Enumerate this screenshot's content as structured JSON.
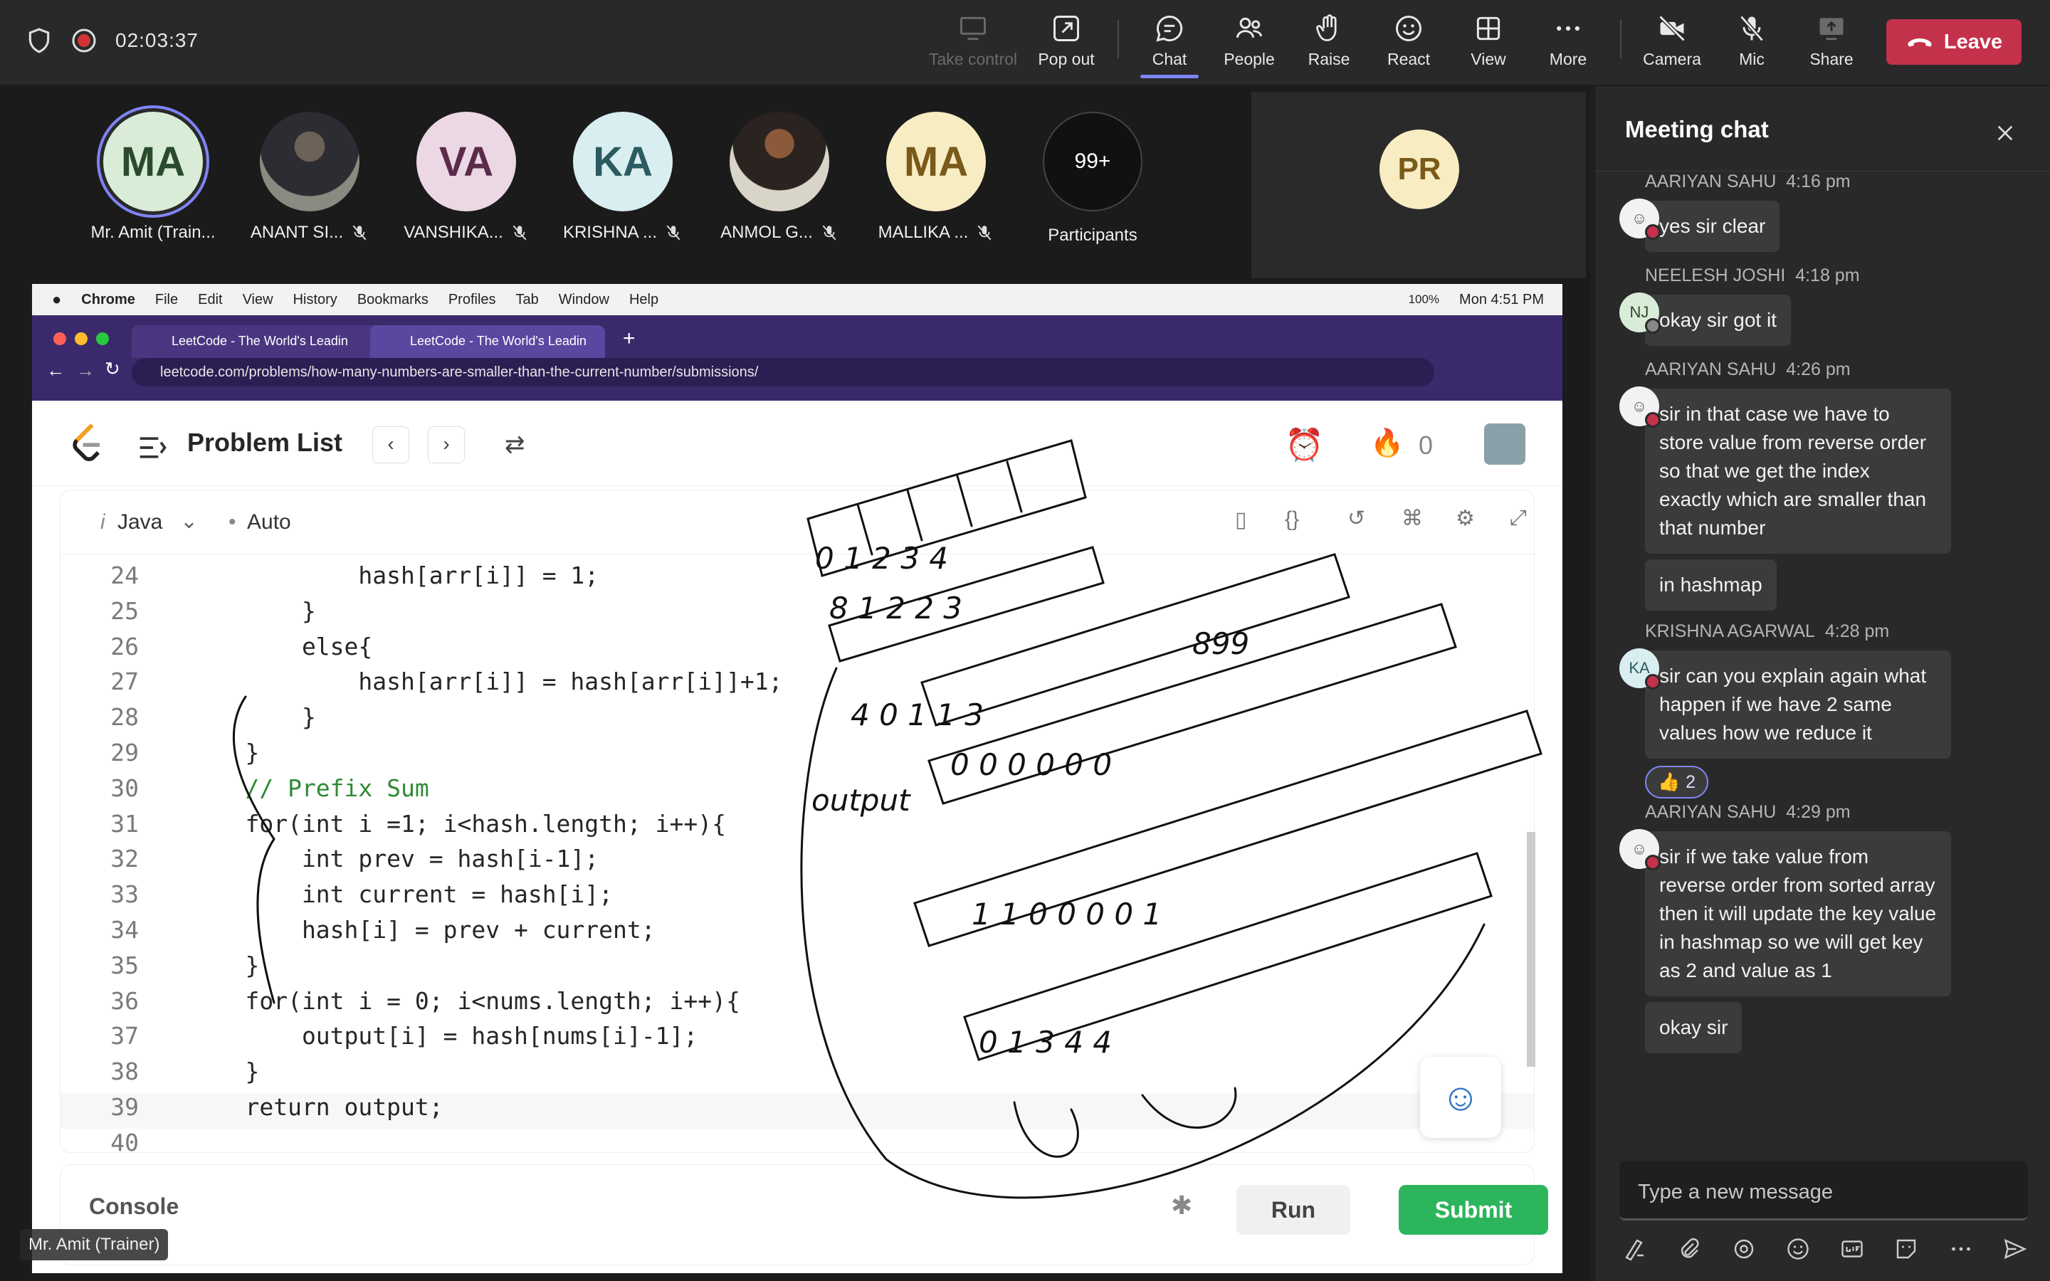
{
  "topbar": {
    "timer": "02:03:37",
    "buttons": {
      "take_control": "Take control",
      "pop_out": "Pop out",
      "chat": "Chat",
      "people": "People",
      "raise": "Raise",
      "react": "React",
      "view": "View",
      "more": "More",
      "camera": "Camera",
      "mic": "Mic",
      "share": "Share",
      "leave": "Leave"
    }
  },
  "participants": [
    {
      "initials": "MA",
      "name": "Mr. Amit (Train..."
    },
    {
      "initials": "",
      "name": "ANANT SI..."
    },
    {
      "initials": "VA",
      "name": "VANSHIKA..."
    },
    {
      "initials": "KA",
      "name": "KRISHNA ..."
    },
    {
      "initials": "",
      "name": "ANMOL G..."
    },
    {
      "initials": "MA",
      "name": "MALLIKA ..."
    }
  ],
  "participants_more": {
    "count": "99+",
    "label": "Participants"
  },
  "pinned_tile": {
    "initials": "PR"
  },
  "shared_screen": {
    "mac_menu": [
      "Chrome",
      "File",
      "Edit",
      "View",
      "History",
      "Bookmarks",
      "Profiles",
      "Tab",
      "Window",
      "Help"
    ],
    "mac_status": {
      "battery": "100%",
      "clock": "Mon 4:51 PM"
    },
    "tabs": [
      "LeetCode - The World's Leadin",
      "LeetCode - The World's Leadin"
    ],
    "url": "leetcode.com/problems/how-many-numbers-are-smaller-than-the-current-number/submissions/",
    "problem_list": "Problem List",
    "streak": "0",
    "language": "Java",
    "autosave": "Auto",
    "code_lines": [
      {
        "n": "24",
        "t": "            hash[arr[i]] = 1;"
      },
      {
        "n": "25",
        "t": "        }"
      },
      {
        "n": "26",
        "t": "        else{"
      },
      {
        "n": "27",
        "t": "            hash[arr[i]] = hash[arr[i]]+1;"
      },
      {
        "n": "28",
        "t": "        }"
      },
      {
        "n": "29",
        "t": "    }"
      },
      {
        "n": "30",
        "t": "    // Prefix Sum"
      },
      {
        "n": "31",
        "t": "    for(int i =1; i<hash.length; i++){"
      },
      {
        "n": "32",
        "t": "        int prev = hash[i-1];"
      },
      {
        "n": "33",
        "t": "        int current = hash[i];"
      },
      {
        "n": "34",
        "t": "        hash[i] = prev + current;"
      },
      {
        "n": "35",
        "t": "    }"
      },
      {
        "n": "36",
        "t": "    for(int i = 0; i<nums.length; i++){"
      },
      {
        "n": "37",
        "t": "        output[i] = hash[nums[i]-1];"
      },
      {
        "n": "38",
        "t": "    }"
      },
      {
        "n": "39",
        "t": "    return output;"
      },
      {
        "n": "40",
        "t": ""
      }
    ],
    "console": "Console",
    "run": "Run",
    "submit": "Submit",
    "presenter_tag": "Mr. Amit (Trainer)"
  },
  "chat": {
    "title": "Meeting chat",
    "messages": [
      {
        "author": "AARIYAN SAHU",
        "time": "4:16 pm",
        "text": "yes sir clear"
      },
      {
        "author": "NEELESH JOSHI",
        "time": "4:18 pm",
        "initials": "NJ",
        "text": "okay sir got it"
      },
      {
        "author": "AARIYAN SAHU",
        "time": "4:26 pm",
        "text": "sir in that case we have to store value from reverse order so that we get the index exactly which are smaller than that number",
        "text2": "in hashmap"
      },
      {
        "author": "KRISHNA AGARWAL",
        "time": "4:28 pm",
        "initials": "KA",
        "text": "sir can you explain again what happen if we have 2 same values how we reduce it",
        "reaction": "2"
      },
      {
        "author": "AARIYAN SAHU",
        "time": "4:29 pm",
        "text": "sir if we take value from reverse order from sorted array then it will update the key value in hashmap so we will get key as 2 and value as 1",
        "text2": "okay sir"
      }
    ],
    "compose_placeholder": "Type a new message"
  },
  "colors": {
    "accent": "#7f85f5",
    "leave": "#c4314b",
    "submit": "#2db55d"
  }
}
